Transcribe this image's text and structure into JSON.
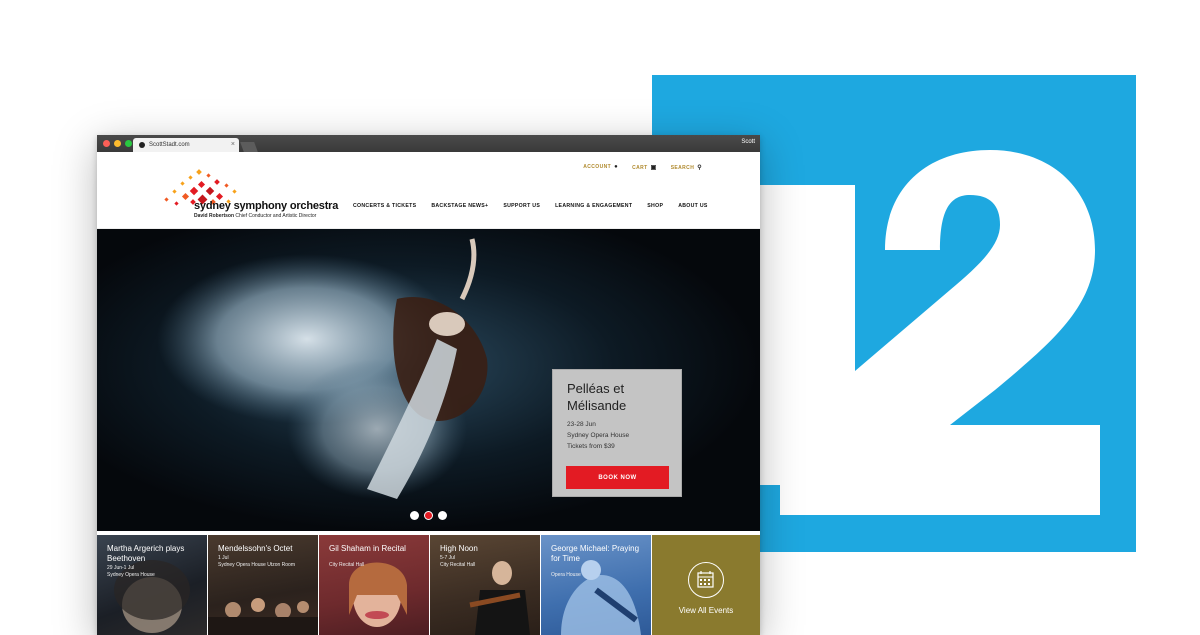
{
  "browser": {
    "tab_title": "ScottStadt.com",
    "tab_close": "×",
    "user_name": "Scott"
  },
  "site": {
    "logo_title": "sydney symphony orchestra",
    "logo_sub_name": "David Robertson",
    "logo_sub_role": "Chief Conductor and Artistic Director",
    "utility": [
      {
        "label": "ACCOUNT",
        "icon": "user-icon"
      },
      {
        "label": "CART",
        "icon": "cart-icon"
      },
      {
        "label": "SEARCH",
        "icon": "search-icon"
      }
    ],
    "nav": [
      "CONCERTS & TICKETS",
      "BACKSTAGE NEWS+",
      "SUPPORT US",
      "LEARNING & ENGAGEMENT",
      "SHOP",
      "ABOUT US"
    ]
  },
  "hero": {
    "title_line1": "Pelléas et",
    "title_line2": "Mélisande",
    "date": "23-28 Jun",
    "venue": "Sydney Opera House",
    "price": "Tickets from $39",
    "button": "BOOK NOW",
    "slides_total": 3,
    "active_slide": 2
  },
  "events": [
    {
      "title": "Martha Argerich plays Beethoven",
      "date": "29 Jun-1 Jul",
      "venue": "Sydney Opera House"
    },
    {
      "title": "Mendelssohn's Octet",
      "date": "1 Jul",
      "venue": "Sydney Opera House Utzon Room"
    },
    {
      "title": "Gil Shaham in Recital",
      "date": "",
      "venue": "City Recital Hall"
    },
    {
      "title": "High Noon",
      "date": "5-7 Jul",
      "venue": "City Recital Hall"
    },
    {
      "title": "George Michael: Praying for Time",
      "date": "",
      "venue": "Opera House"
    }
  ],
  "view_all": "View All Events",
  "brand_number": "12",
  "colors": {
    "accent_red": "#e31b23",
    "brand_blue": "#1ea8e0",
    "gold": "#b08a2e",
    "olive": "#8a7a2e"
  }
}
